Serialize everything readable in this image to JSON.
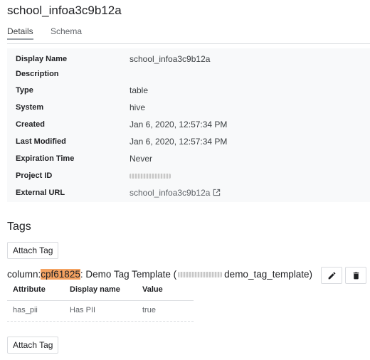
{
  "page": {
    "title": "school_infoa3c9b12a"
  },
  "tabs": [
    {
      "label": "Details"
    },
    {
      "label": "Schema"
    }
  ],
  "details": {
    "rows": [
      {
        "label": "Display Name",
        "value": "school_infoa3c9b12a"
      },
      {
        "label": "Description",
        "value": ""
      },
      {
        "label": "Type",
        "value": "table"
      },
      {
        "label": "System",
        "value": "hive"
      },
      {
        "label": "Created",
        "value": "Jan 6, 2020, 12:57:34 PM"
      },
      {
        "label": "Last Modified",
        "value": "Jan 6, 2020, 12:57:34 PM"
      },
      {
        "label": "Expiration Time",
        "value": "Never"
      },
      {
        "label": "Project ID",
        "value": ""
      },
      {
        "label": "External URL",
        "value": "school_infoa3c9b12a",
        "icon": "external-link-icon"
      }
    ]
  },
  "tags": {
    "heading": "Tags",
    "attach_label": "Attach Tag",
    "tag": {
      "prefix": "column:",
      "column": "cpf61825",
      "template_label": ": Demo Tag Template (",
      "template_id_suffix": "demo_tag_template)",
      "highlight_color": "#f4a261",
      "edit_icon": "pencil-icon",
      "delete_icon": "trash-icon",
      "headers": {
        "attribute": "Attribute",
        "display_name": "Display name",
        "value": "Value"
      },
      "rows": [
        {
          "attribute": "has_pii",
          "display_name": "Has PII",
          "value": "true"
        }
      ]
    }
  }
}
